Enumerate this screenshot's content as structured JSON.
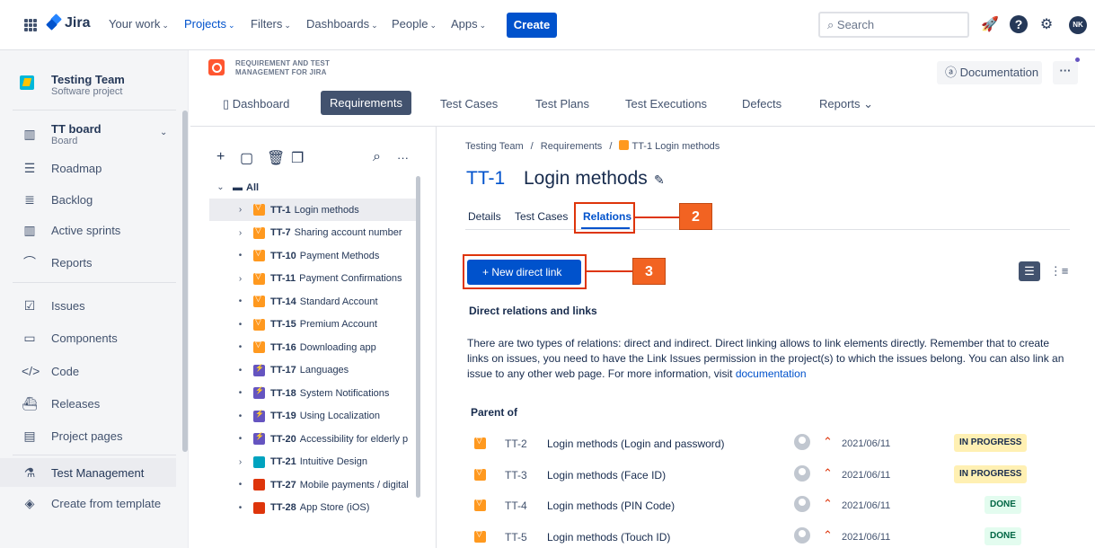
{
  "topnav": {
    "logo_text": "Jira",
    "items": [
      {
        "label": "Your work",
        "active": false
      },
      {
        "label": "Projects",
        "active": true
      },
      {
        "label": "Filters",
        "active": false
      },
      {
        "label": "Dashboards",
        "active": false
      },
      {
        "label": "People",
        "active": false
      },
      {
        "label": "Apps",
        "active": false
      }
    ],
    "create_label": "Create",
    "search_placeholder": "Search",
    "avatar_initials": "NK"
  },
  "sidebar": {
    "project_name": "Testing Team",
    "project_type": "Software project",
    "board_title": "TT board",
    "board_sub": "Board",
    "items": [
      {
        "label": "Roadmap",
        "icon": "roadmap-icon"
      },
      {
        "label": "Backlog",
        "icon": "backlog-icon"
      },
      {
        "label": "Active sprints",
        "icon": "sprints-icon"
      },
      {
        "label": "Reports",
        "icon": "reports-icon"
      },
      {
        "label": "Issues",
        "icon": "issues-icon"
      },
      {
        "label": "Components",
        "icon": "components-icon"
      },
      {
        "label": "Code",
        "icon": "code-icon"
      },
      {
        "label": "Releases",
        "icon": "releases-icon"
      },
      {
        "label": "Project pages",
        "icon": "pages-icon"
      },
      {
        "label": "Test Management",
        "icon": "test-management-icon"
      },
      {
        "label": "Create from template",
        "icon": "template-icon"
      }
    ]
  },
  "app": {
    "name_line1": "REQUIREMENT AND TEST",
    "name_line2": "MANAGEMENT FOR JIRA",
    "tabs": [
      "Dashboard",
      "Requirements",
      "Test Cases",
      "Test Plans",
      "Test Executions",
      "Defects",
      "Reports"
    ],
    "doc_label": "Documentation",
    "more_label": "···"
  },
  "tree": {
    "root_label": "All",
    "rows": [
      {
        "key": "TT-1",
        "name": "Login methods",
        "type": "req",
        "toggle": "›"
      },
      {
        "key": "TT-7",
        "name": "Sharing account number",
        "type": "req",
        "toggle": "›"
      },
      {
        "key": "TT-10",
        "name": "Payment Methods",
        "type": "req",
        "toggle": "•"
      },
      {
        "key": "TT-11",
        "name": "Payment Confirmations",
        "type": "req",
        "toggle": "›"
      },
      {
        "key": "TT-14",
        "name": "Standard Account",
        "type": "req",
        "toggle": "•"
      },
      {
        "key": "TT-15",
        "name": "Premium Account",
        "type": "req",
        "toggle": "•"
      },
      {
        "key": "TT-16",
        "name": "Downloading app",
        "type": "req",
        "toggle": "•"
      },
      {
        "key": "TT-17",
        "name": "Languages",
        "type": "story",
        "toggle": "•"
      },
      {
        "key": "TT-18",
        "name": "System Notifications",
        "type": "story",
        "toggle": "•"
      },
      {
        "key": "TT-19",
        "name": "Using Localization",
        "type": "story",
        "toggle": "•"
      },
      {
        "key": "TT-20",
        "name": "Accessibility for elderly p",
        "type": "story",
        "toggle": "•"
      },
      {
        "key": "TT-21",
        "name": "Intuitive Design",
        "type": "task",
        "toggle": "›"
      },
      {
        "key": "TT-27",
        "name": "Mobile payments / digital",
        "type": "bug",
        "toggle": "•"
      },
      {
        "key": "TT-28",
        "name": "App Store (iOS)",
        "type": "bug",
        "toggle": "•"
      }
    ]
  },
  "main": {
    "breadcrumb": [
      "Testing Team",
      "Requirements",
      "TT-1 Login methods"
    ],
    "issue_key": "TT-1",
    "issue_title": "Login methods",
    "subtabs": [
      "Details",
      "Test Cases",
      "Relations"
    ],
    "callout_2": "2",
    "callout_3": "3",
    "new_link_label": "+   New direct link",
    "section_title": "Direct relations and links",
    "description": "There are two types of relations: direct and indirect. Direct linking allows to link elements directly. Remember that to create links on issues, you need to have the Link Issues permission in the project(s) to which the issues belong. You can also link an issue to any other web page. For more information, visit ",
    "doc_link": "documentation",
    "parent_title": "Parent of",
    "relations": [
      {
        "key": "TT-2",
        "name": "Login methods (Login and password)",
        "date": "2021/06/11",
        "status": "IN PROGRESS"
      },
      {
        "key": "TT-3",
        "name": "Login methods (Face ID)",
        "date": "2021/06/11",
        "status": "IN PROGRESS"
      },
      {
        "key": "TT-4",
        "name": "Login methods (PIN Code)",
        "date": "2021/06/11",
        "status": "DONE"
      },
      {
        "key": "TT-5",
        "name": "Login methods (Touch ID)",
        "date": "2021/06/11",
        "status": "DONE"
      }
    ]
  }
}
